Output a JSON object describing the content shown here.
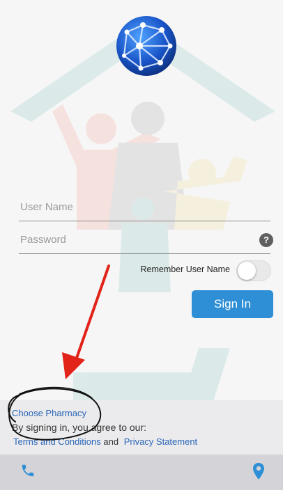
{
  "login": {
    "username_placeholder": "User Name",
    "password_placeholder": "Password",
    "help_symbol": "?",
    "remember_label": "Remember User Name",
    "remember_enabled": false,
    "signin_label": "Sign In"
  },
  "footer": {
    "choose_pharmacy": "Choose Pharmacy",
    "agree_text": "By signing in, you agree to our:",
    "terms_link": "Terms and Conditions",
    "and_text": "and",
    "privacy_link": "Privacy Statement"
  },
  "bottom_bar": {
    "left_icon": "phone-icon",
    "right_icon": "location-pin-icon"
  },
  "colors": {
    "accent": "#2f8fd6",
    "link": "#2a66b8",
    "annotation_arrow": "#e2231a"
  }
}
